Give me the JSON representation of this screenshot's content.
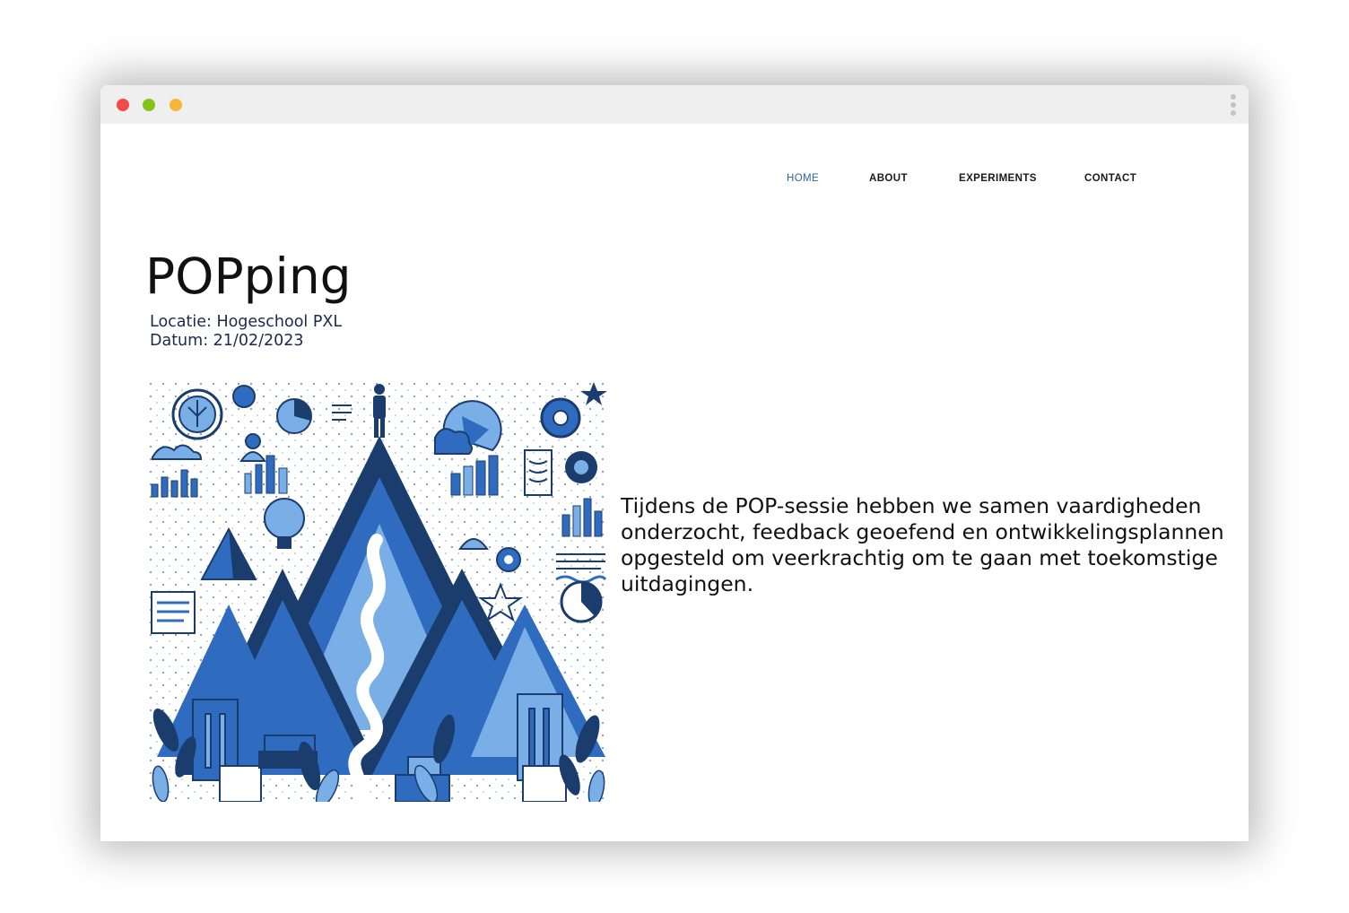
{
  "window": {
    "controls": [
      "close",
      "minimize",
      "maximize"
    ],
    "menu_icon": "kebab-menu-icon"
  },
  "nav": {
    "items": [
      {
        "label": "HOME",
        "active": true
      },
      {
        "label": "ABOUT",
        "active": false
      },
      {
        "label": "EXPERIMENTS",
        "active": false
      },
      {
        "label": "CONTACT",
        "active": false
      }
    ],
    "active_color": "#2e62a8"
  },
  "page": {
    "title": "POPping",
    "location": "Locatie: Hogeschool PXL",
    "date": "Datum: 21/02/2023",
    "description": "Tijdens de POP-sessie hebben we samen vaardigheden onderzocht, feedback geoefend en ontwikkelingsplannen opgesteld om veerkrachtig om te gaan met toekomstige uitdagingen."
  },
  "hero_image": {
    "subject": "mountain-path-growth-illustration",
    "colors": [
      "#1b3d6e",
      "#2f6cc0",
      "#7aaee6",
      "#ffffff"
    ]
  }
}
